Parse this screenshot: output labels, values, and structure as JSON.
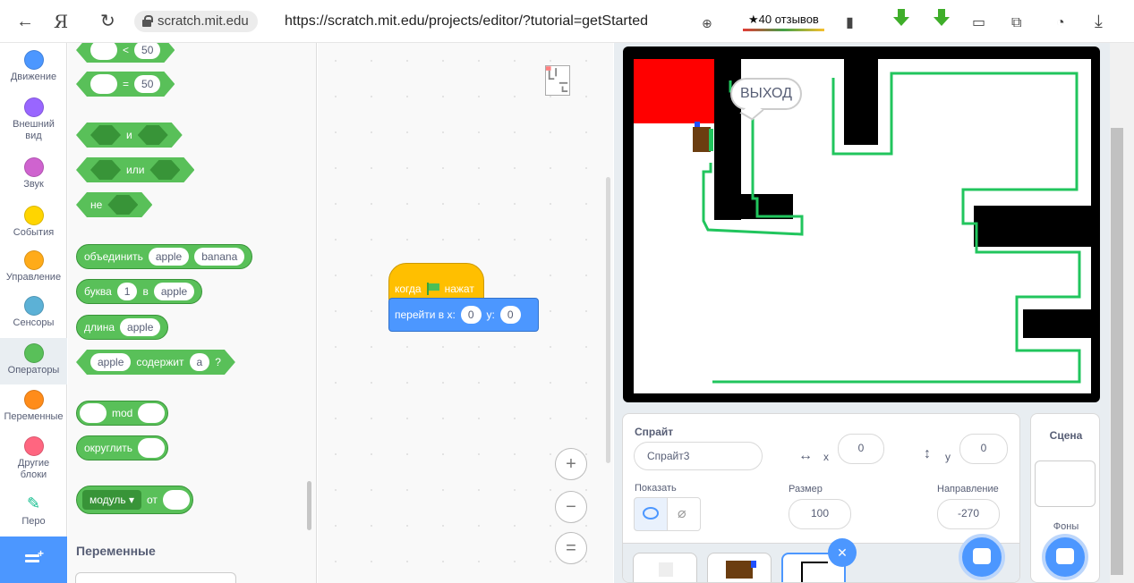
{
  "browser": {
    "host": "scratch.mit.edu",
    "url": "https://scratch.mit.edu/projects/editor/?tutorial=getStarted",
    "reviews": "★40 отзывов"
  },
  "categories": [
    {
      "label": "Движение",
      "color": "#4c97ff"
    },
    {
      "label": "Внешний вид",
      "color": "#9966ff"
    },
    {
      "label": "Звук",
      "color": "#cf63cf"
    },
    {
      "label": "События",
      "color": "#ffd500"
    },
    {
      "label": "Управление",
      "color": "#ffab19"
    },
    {
      "label": "Сенсоры",
      "color": "#5cb1d6"
    },
    {
      "label": "Операторы",
      "color": "#59c059"
    },
    {
      "label": "Переменные",
      "color": "#ff8c1a"
    },
    {
      "label": "Другие блоки",
      "color": "#ff6680"
    },
    {
      "label": "Перо",
      "color": "#0fbd8c"
    }
  ],
  "palette": {
    "lt_value": "50",
    "lt_op": "<",
    "eq_value": "50",
    "eq_op": "=",
    "and_label": "и",
    "or_label": "или",
    "not_label": "не",
    "join": {
      "label": "объединить",
      "a": "apple",
      "b": "banana"
    },
    "letter": {
      "label": "буква",
      "index": "1",
      "of": "в",
      "word": "apple"
    },
    "length": {
      "label": "длина",
      "word": "apple"
    },
    "contains": {
      "word": "apple",
      "label": "содержит",
      "value": "a",
      "q": "?"
    },
    "mod_label": "mod",
    "round_label": "округлить",
    "math": {
      "dropdown": "модуль ▾",
      "of": "от"
    },
    "variables_heading": "Переменные"
  },
  "script": {
    "event_prefix": "когда",
    "event_suffix": "нажат",
    "goto_label": "перейти в x:",
    "x_value": "0",
    "y_label": "y:",
    "y_value": "0"
  },
  "zoom": {
    "in": "+",
    "out": "−",
    "reset": "="
  },
  "stage": {
    "speech": "ВЫХОД"
  },
  "sprite_info": {
    "title": "Спрайт",
    "name": "Спрайт3",
    "x_label": "x",
    "x": "0",
    "y_label": "y",
    "y": "0",
    "show_label": "Показать",
    "size_label": "Размер",
    "size": "100",
    "direction_label": "Направление",
    "direction": "-270"
  },
  "stage_panel": {
    "title": "Сцена",
    "backdrops": "Фоны"
  }
}
